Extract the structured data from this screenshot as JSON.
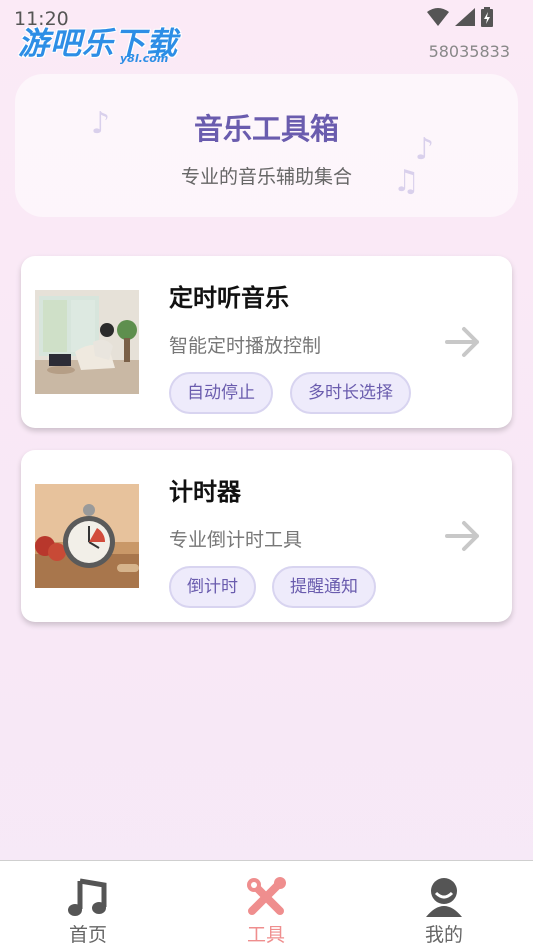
{
  "status_bar": {
    "time": "11:20",
    "device_id": "58035833"
  },
  "watermark": {
    "title": "游吧乐下载",
    "sub": "y8l.com"
  },
  "header": {
    "title": "音乐工具箱",
    "subtitle": "专业的音乐辅助集合"
  },
  "cards": [
    {
      "title": "定时听音乐",
      "description": "智能定时播放控制",
      "tags": [
        "自动停止",
        "多时长选择"
      ]
    },
    {
      "title": "计时器",
      "description": "专业倒计时工具",
      "tags": [
        "倒计时",
        "提醒通知"
      ]
    }
  ],
  "bottom_nav": {
    "items": [
      {
        "label": "首页",
        "icon": "music-note-icon",
        "active": false
      },
      {
        "label": "工具",
        "icon": "tools-icon",
        "active": true
      },
      {
        "label": "我的",
        "icon": "profile-icon",
        "active": false
      }
    ]
  },
  "colors": {
    "accent": "#6a5cae",
    "active_tab": "#ef8e8e",
    "tag_bg": "#eeebfb"
  }
}
